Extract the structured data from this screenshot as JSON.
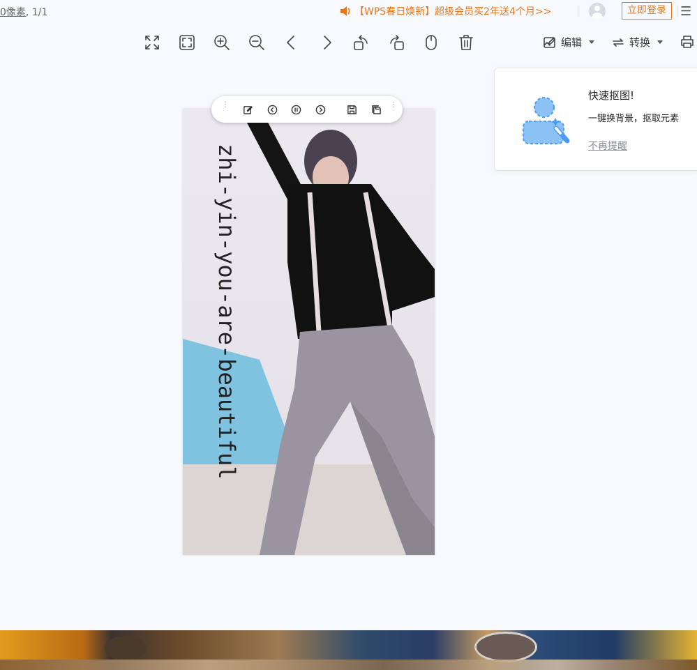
{
  "topbar": {
    "pixel_info_prefix": "0像素",
    "pixel_info_suffix": ", 1/1",
    "promo_text": "【WPS春日焕新】超级会员买2年送4个月>>",
    "login_label": "立即登录",
    "menu_glyph": "☰"
  },
  "toolbar": {
    "icons": [
      "fullscreen-icon",
      "fit-window-icon",
      "zoom-in-icon",
      "zoom-out-icon",
      "previous-icon",
      "next-icon",
      "rotate-left-icon",
      "rotate-right-icon",
      "mouse-icon",
      "delete-icon"
    ],
    "edit_label": "编辑",
    "convert_label": "转换",
    "print_icon": "print-icon"
  },
  "image": {
    "caption": "zhi-yin-you-are-beautiful"
  },
  "float_toolbar": {
    "icons": [
      "drag-handle-icon",
      "edit-icon",
      "prev-frame-icon",
      "pause-icon",
      "next-frame-icon",
      "save-icon",
      "save-as-icon",
      "more-icon"
    ]
  },
  "popup": {
    "title": "快速抠图!",
    "description": "一键换背景，抠取元素",
    "dismiss_label": "不再提醒"
  },
  "colors": {
    "accent": "#e8771a",
    "background": "#f7f9fc",
    "icon_blue": "#4a9cf5"
  }
}
